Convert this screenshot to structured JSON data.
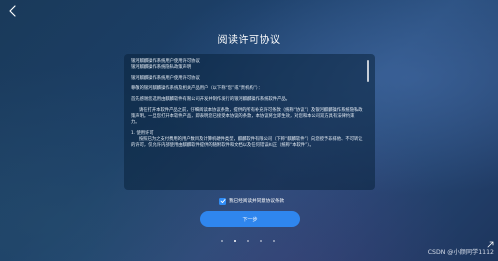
{
  "window": {
    "title": "阅读许可协议"
  },
  "agreement": {
    "lines": [
      "银河麒麟操作系统用户使用许可协议",
      "银河麒麟操作系统隐私政策声明",
      "",
      "银河麒麟操作系统用户使用许可协议",
      "",
      "尊敬的银河麒麟操作系统及相关产品用户（以下称“您”或“贵机构”）：",
      "",
      "首先感谢您选用由麒麟软件有限公司开发并制作发行的银河麒麟操作系统软件产品。",
      "",
      "请在打开本软件产品之前，仔细阅读本协议条款，提供的所有补充许可条款（统称“协议”）及银河麒麟操作系统隐私政策声明。一旦您打开本软件产品，即表明您已接受本协议的条款，本协议将立即生效，对您和本公司双方具有法律约束力。",
      "",
      "1. 使用许可",
      "按照已为之支付费用的用户数目及计算机硬件类型，麒麟软件有限公司（下称“麒麟软件”）向您授予非排他、不可转让的许可，仅允许内部使用由麒麟软件提供的随附软件和文档以及任何错误纠正（统称“本软件”）。"
    ]
  },
  "agree_checkbox": {
    "label": "我已经阅读并同意协议条款",
    "checked": true
  },
  "next_button": {
    "label": "下一步"
  },
  "pager": {
    "pages": 5,
    "active_index": 1
  },
  "watermark": "CSDN @小颜同学1112",
  "colors": {
    "accent": "#2f86ee",
    "text": "#ffffff"
  },
  "icons": {
    "back": "back-arrow-icon",
    "check": "checkmark-icon",
    "corner": "cursor-icon"
  }
}
